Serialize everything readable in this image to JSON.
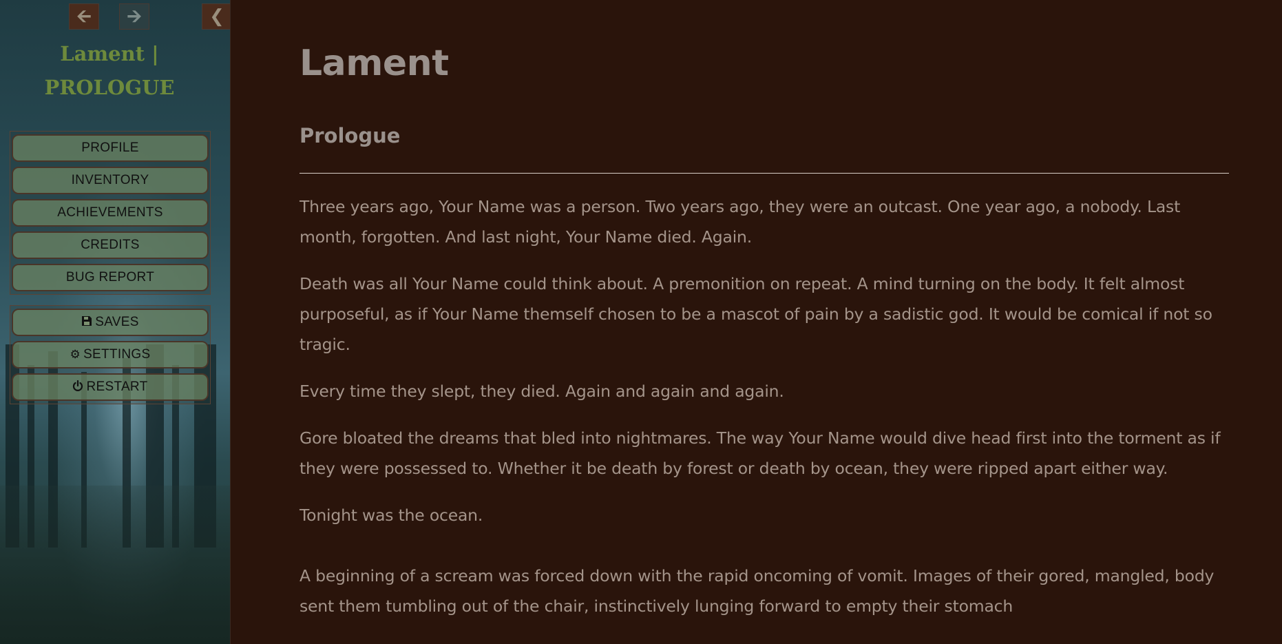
{
  "sidebar": {
    "nav": {
      "back_icon": "arrow-left-icon",
      "forward_icon": "arrow-right-icon",
      "collapse_icon": "chevron-left-icon"
    },
    "story_title_line1": "Lament |",
    "story_title_line2": "PROLOGUE",
    "menu": [
      {
        "label": "PROFILE"
      },
      {
        "label": "INVENTORY"
      },
      {
        "label": "ACHIEVEMENTS"
      },
      {
        "label": "CREDITS"
      },
      {
        "label": "BUG REPORT"
      }
    ],
    "system_menu": [
      {
        "label": "SAVES",
        "icon": "save-icon"
      },
      {
        "label": "SETTINGS",
        "icon": "gear-icon"
      },
      {
        "label": "RESTART",
        "icon": "power-icon"
      }
    ]
  },
  "main": {
    "title": "Lament",
    "section": "Prologue",
    "paragraphs": [
      "Three years ago, Your Name was a person. Two years ago, they were an outcast. One year ago, a nobody. Last month, forgotten. And last night, Your Name died. Again.",
      "Death was all Your Name could think about. A premonition on repeat. A mind turning on the body. It felt almost purposeful, as if Your Name themself chosen to be a mascot of pain by a sadistic god. It would be comical if not so tragic.",
      "Every time they slept, they died. Again and again and again.",
      "Gore bloated the dreams that bled into nightmares. The way Your Name would dive head first into the torment as if they were possessed to. Whether it be death by forest or death by ocean, they were ripped apart either way.",
      "Tonight was the ocean.",
      "A beginning of a scream was forced down with the rapid oncoming of vomit. Images of their gored, mangled, body sent them tumbling out of the chair, instinctively lunging forward to empty their stomach"
    ]
  },
  "colors": {
    "background": "#2a140b",
    "story_title": "#6e8a3c",
    "menu_button": "#6e8764",
    "text": "#a4948a"
  }
}
